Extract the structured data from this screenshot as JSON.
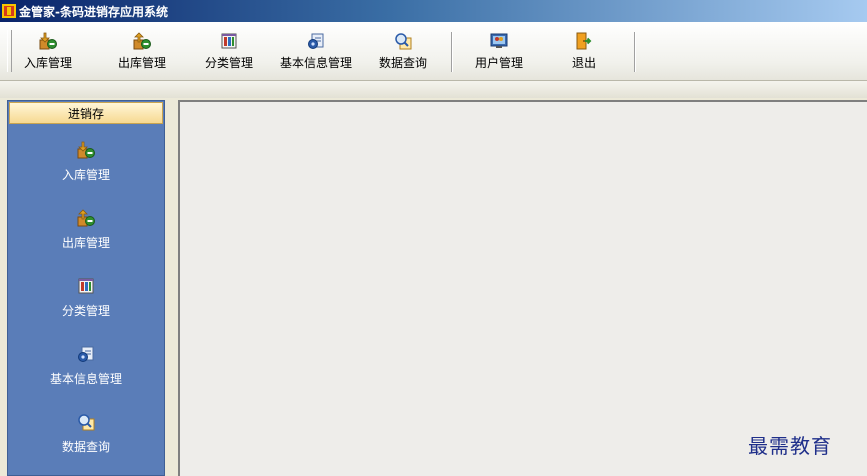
{
  "window": {
    "title": "金管家-条码进销存应用系统"
  },
  "toolbar": {
    "items": [
      {
        "label": "入库管理",
        "icon": "stock-in-icon"
      },
      {
        "label": "出库管理",
        "icon": "stock-out-icon"
      },
      {
        "label": "分类管理",
        "icon": "category-icon"
      },
      {
        "label": "基本信息管理",
        "icon": "basic-info-icon"
      },
      {
        "label": "数据查询",
        "icon": "data-query-icon"
      },
      {
        "label": "用户管理",
        "icon": "user-management-icon"
      },
      {
        "label": "退出",
        "icon": "exit-icon"
      }
    ]
  },
  "sidebar": {
    "header": "进销存",
    "items": [
      {
        "label": "入库管理",
        "icon": "stock-in-icon"
      },
      {
        "label": "出库管理",
        "icon": "stock-out-icon"
      },
      {
        "label": "分类管理",
        "icon": "category-icon"
      },
      {
        "label": "基本信息管理",
        "icon": "basic-info-icon"
      },
      {
        "label": "数据查询",
        "icon": "data-query-icon"
      }
    ]
  },
  "watermark": "最需教育",
  "colors": {
    "titlebar_start": "#0a246a",
    "sidebar_bg": "#5a7db8",
    "sidebar_header_bg": "#f7d991",
    "workspace_bg": "#eeedea"
  }
}
